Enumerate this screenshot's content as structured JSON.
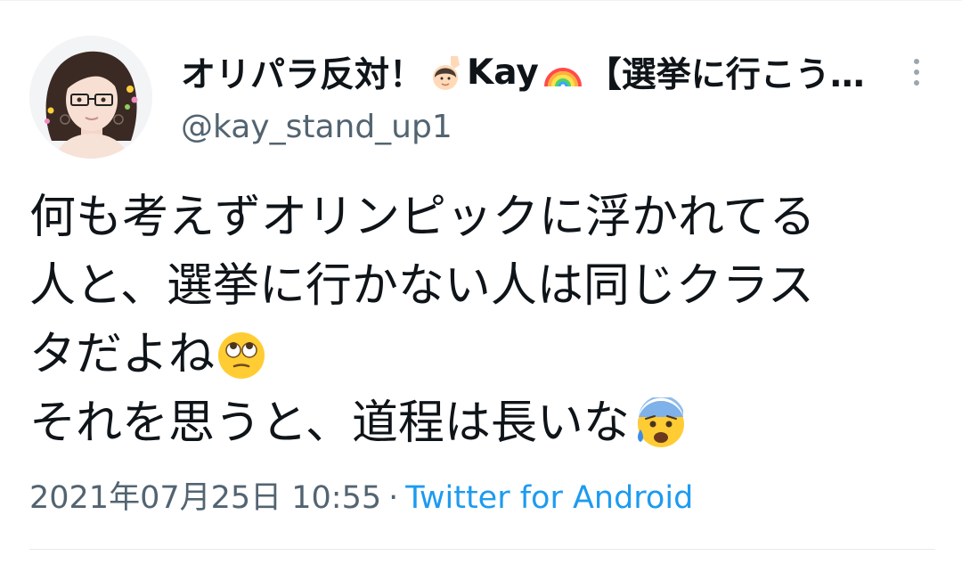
{
  "tweet": {
    "display_name": {
      "part1": "オリパラ反対！",
      "part2": "Kay",
      "part3": "【選挙に行こう…"
    },
    "handle": "@kay_stand_up1",
    "body": {
      "line1": "何も考えずオリンピックに浮かれてる",
      "line2": "人と、選挙に行かない人は同じクラス",
      "line3": "タだよね",
      "line4": "それを思うと、道程は長いな"
    },
    "timestamp": "2021年07月25日 10:55",
    "separator": "·",
    "source": "Twitter for Android"
  },
  "icons": {
    "avatar": "avatar-illustration",
    "name_emoji_1": "person-raising-hand-emoji",
    "name_emoji_2": "rainbow-emoji",
    "body_emoji_1": "face-with-rolling-eyes-emoji",
    "body_emoji_2": "anxious-face-with-sweat-emoji",
    "more": "more-options-icon"
  },
  "colors": {
    "text": "#0f1419",
    "secondary": "#536471",
    "link": "#1d9bf0"
  }
}
